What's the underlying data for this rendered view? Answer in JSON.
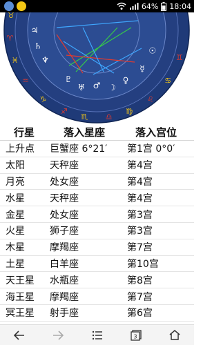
{
  "status_bar": {
    "battery": "64%",
    "time": "18:04"
  },
  "chart": {
    "outer_signs": [
      "♓",
      "♒",
      "♑",
      "♐",
      "♏",
      "♎",
      "♍",
      "♌",
      "♋",
      "♊",
      "♈",
      "♉"
    ],
    "inner_glyphs": [
      "♄",
      "♆",
      "♇",
      "♅",
      "♂",
      "☽",
      "♀",
      "☿",
      "☉",
      "♃"
    ]
  },
  "table": {
    "headers": [
      "行星",
      "落入星座",
      "落入宫位"
    ],
    "rows": [
      {
        "planet": "上升点",
        "sign": "巨蟹座 6°21′",
        "house": "第1宫 0°0′"
      },
      {
        "planet": "太阳",
        "sign": "天秤座",
        "house": "第4宫"
      },
      {
        "planet": "月亮",
        "sign": "处女座",
        "house": "第4宫"
      },
      {
        "planet": "水星",
        "sign": "天秤座",
        "house": "第4宫"
      },
      {
        "planet": "金星",
        "sign": "处女座",
        "house": "第3宫"
      },
      {
        "planet": "火星",
        "sign": "狮子座",
        "house": "第3宫"
      },
      {
        "planet": "木星",
        "sign": "摩羯座",
        "house": "第7宫"
      },
      {
        "planet": "土星",
        "sign": "白羊座",
        "house": "第10宫"
      },
      {
        "planet": "天王星",
        "sign": "水瓶座",
        "house": "第8宫"
      },
      {
        "planet": "海王星",
        "sign": "摩羯座",
        "house": "第7宫"
      },
      {
        "planet": "冥王星",
        "sign": "射手座",
        "house": "第6宫"
      }
    ]
  },
  "nav_bar": {
    "icons": [
      "back-arrow-icon",
      "forward-arrow-icon",
      "menu-list-icon",
      "tabs-icon",
      "home-icon"
    ],
    "tabs_count": "3"
  },
  "colors": {
    "chart_ring": "#1f3a78",
    "chart_inner": "#2c4c92",
    "sign_red": "#e23b2f",
    "sign_yellow": "#f0c419",
    "line_green": "#37c84a",
    "line_blue": "#3fa7ff"
  }
}
